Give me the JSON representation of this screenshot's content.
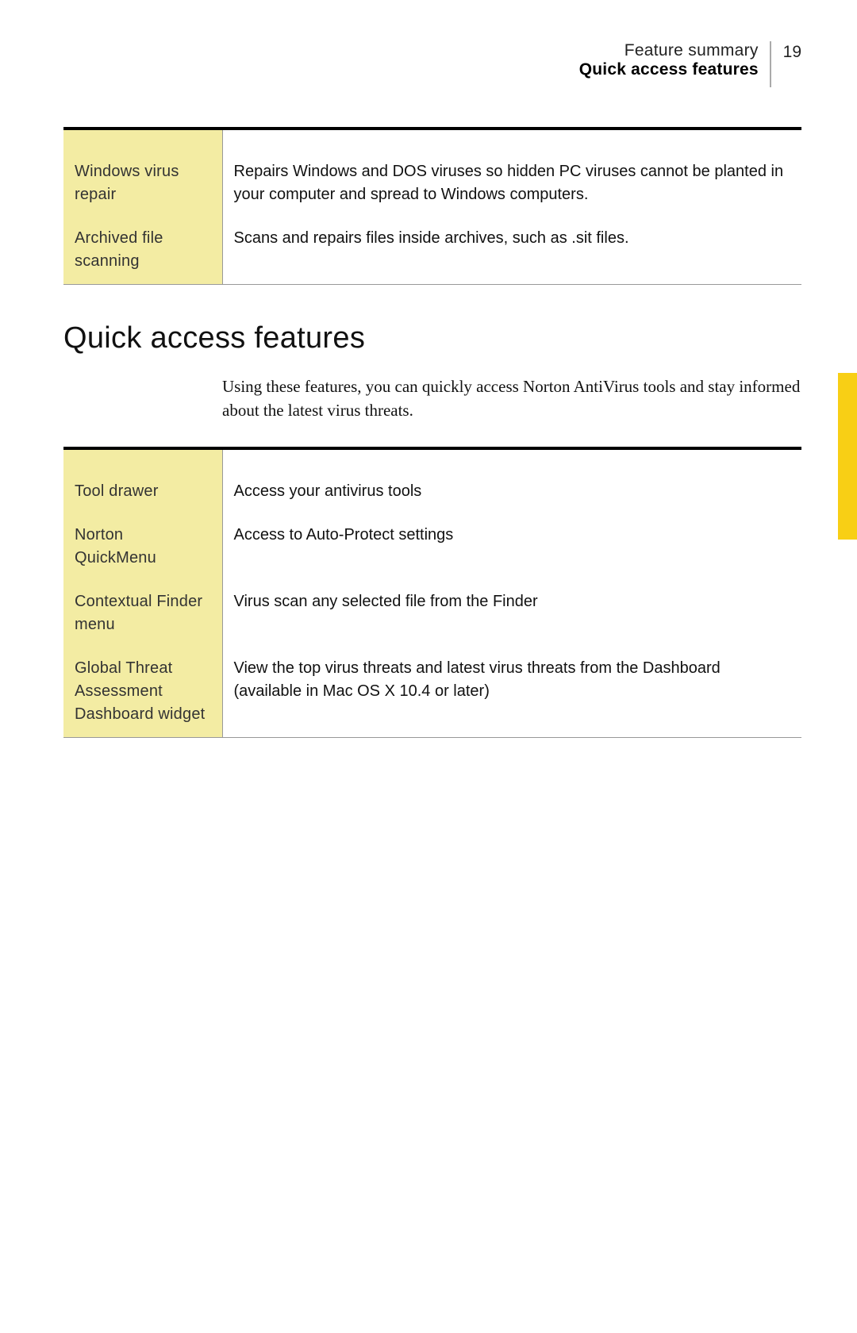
{
  "header": {
    "breadcrumb": "Feature summary",
    "section": "Quick access features",
    "page_number": "19"
  },
  "table1": {
    "rows": [
      {
        "term": "Windows virus repair",
        "desc": "Repairs Windows and DOS viruses so hidden PC viruses cannot be planted in your computer and spread to Windows computers."
      },
      {
        "term": "Archived file scanning",
        "desc": "Scans and repairs files inside archives, such as .sit files."
      }
    ]
  },
  "section_heading": "Quick access features",
  "intro": "Using these features, you can quickly access Norton AntiVirus tools and stay informed about the latest virus threats.",
  "table2": {
    "rows": [
      {
        "term": "Tool drawer",
        "desc": "Access your antivirus tools"
      },
      {
        "term": "Norton QuickMenu",
        "desc": "Access to Auto-Protect settings"
      },
      {
        "term": "Contextual Finder menu",
        "desc": "Virus scan any selected file from the Finder"
      },
      {
        "term": "Global Threat Assessment Dashboard widget",
        "desc": "View the top virus threats and latest virus threats from the Dashboard (available in Mac OS X 10.4 or later)"
      }
    ]
  }
}
